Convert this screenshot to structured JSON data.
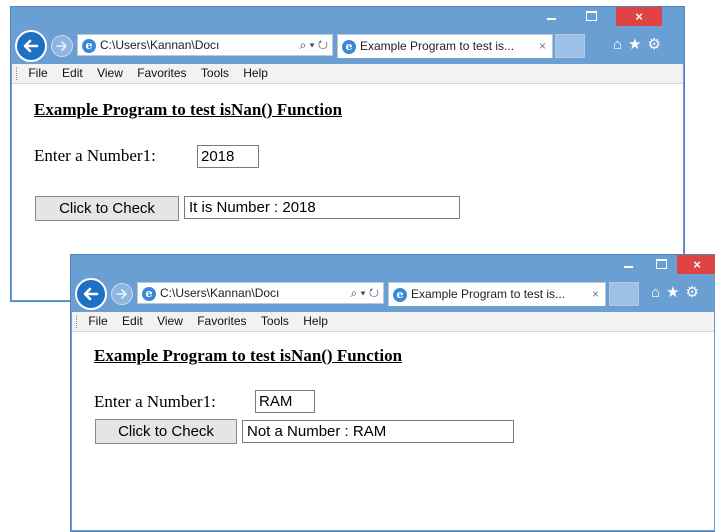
{
  "windows": [
    {
      "address": "C:\\Users\\Kannan\\Docı",
      "address_controls": "⌕ ▾ ↻",
      "tab_title": "Example Program to test is...",
      "tab_close": "×",
      "menu": [
        "File",
        "Edit",
        "View",
        "Favorites",
        "Tools",
        "Help"
      ],
      "heading": "Example Program to test isNan() Function",
      "input_label": "Enter a Number1:",
      "input_value": "2018",
      "button_label": "Click to Check",
      "result_value": "It is Number : 2018"
    },
    {
      "address": "C:\\Users\\Kannan\\Docı",
      "address_controls": "⌕ ▾ ↻",
      "tab_title": "Example Program to test is...",
      "tab_close": "×",
      "menu": [
        "File",
        "Edit",
        "View",
        "Favorites",
        "Tools",
        "Help"
      ],
      "heading": "Example Program to test isNan() Function",
      "input_label": "Enter a Number1:",
      "input_value": "RAM",
      "button_label": "Click to Check",
      "result_value": "Not a Number : RAM"
    }
  ],
  "caption": {
    "minimize": "–",
    "close": "×"
  },
  "toolbar_icons": [
    "home-icon",
    "favorites-star-icon",
    "settings-gear-icon"
  ],
  "colors": {
    "frame": "#6a9fd4",
    "close": "#e04343",
    "back_button": "#1f6fc4"
  }
}
